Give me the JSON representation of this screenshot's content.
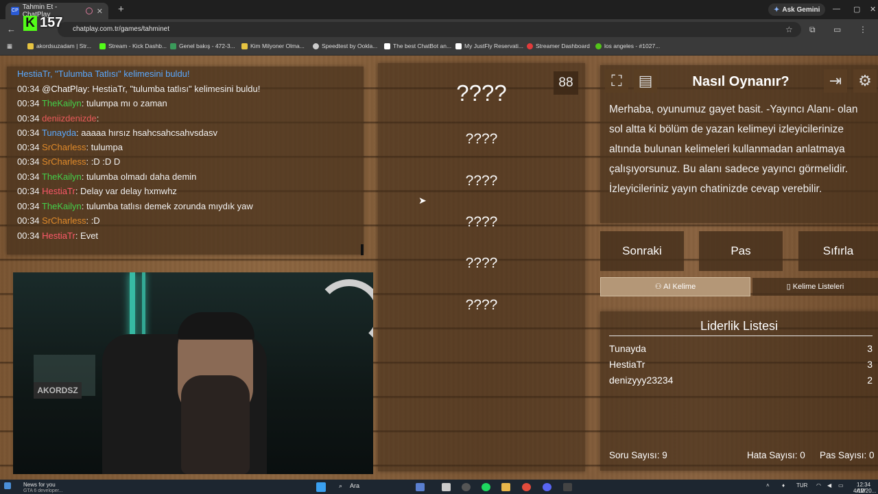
{
  "browser": {
    "tab_title": "Tahmin Et - ChatPlay",
    "url": "chatplay.com.tr/games/tahminet",
    "gemini_label": "Ask Gemini",
    "kick_count": "157",
    "bookmarks": [
      {
        "label": "akordsuzadam | Str...",
        "color": "#e7c441"
      },
      {
        "label": "Stream - Kick Dashb...",
        "color": "#53fc18"
      },
      {
        "label": "Genel bakış - 472-3...",
        "color": "#3a9a5a"
      },
      {
        "label": "Kim Milyoner Olma...",
        "color": "#e7c441"
      },
      {
        "label": "Speedtest by Ookla...",
        "color": "#cccccc"
      },
      {
        "label": "The best ChatBot an...",
        "color": "#ffffff"
      },
      {
        "label": "My JustFly Reservati...",
        "color": "#ffffff"
      },
      {
        "label": "Streamer Dashboard",
        "color": "#e23b3b"
      },
      {
        "label": "los angeles - #1027...",
        "color": "#53c41a"
      }
    ]
  },
  "chat": {
    "header": "HestiaTr, \"Tulumba Tatlısı\" kelimesini buldu!",
    "lines": [
      {
        "time": "00:34",
        "user": "@ChatPlay",
        "msg": ": HestiaTr, \"tulumba tatlısı\" kelimesini buldu!",
        "color": "#ffffff"
      },
      {
        "time": "00:34",
        "user": "TheKailyn",
        "msg": ": tulumpa mı o zaman",
        "color": "#43d14a"
      },
      {
        "time": "00:34",
        "user": "deniizdenizde",
        "msg": ":",
        "color": "#e85a5a"
      },
      {
        "time": "00:34",
        "user": "Tunayda",
        "msg": ": aaaaa hırsız hsahcsahcsahvsdasv",
        "color": "#5aa9ff"
      },
      {
        "time": "00:34",
        "user": "SrCharless",
        "msg": ": tulumpa",
        "color": "#e08a2a"
      },
      {
        "time": "00:34",
        "user": "SrCharless",
        "msg": ": :D :D D",
        "color": "#e08a2a"
      },
      {
        "time": "00:34",
        "user": "TheKailyn",
        "msg": ": tulumba olmadı daha demin",
        "color": "#43d14a"
      },
      {
        "time": "00:34",
        "user": "HestiaTr",
        "msg": ": Delay var delay hxmwhz",
        "color": "#ff5a6a"
      },
      {
        "time": "00:34",
        "user": "TheKailyn",
        "msg": ": tulumba tatlısı demek zorunda mıydık yaw",
        "color": "#43d14a"
      },
      {
        "time": "00:34",
        "user": "SrCharless",
        "msg": ": :D",
        "color": "#e08a2a"
      },
      {
        "time": "00:34",
        "user": "HestiaTr",
        "msg": ": Evet",
        "color": "#ff5a6a"
      }
    ]
  },
  "game": {
    "timer": "88",
    "main_word": "????",
    "words": [
      "????",
      "????",
      "????",
      "????",
      "????"
    ]
  },
  "howto": {
    "title": "Nasıl Oynanır?",
    "text": "Merhaba, oyunumuz gayet basit. -Yayıncı Alanı- olan sol altta ki bölüm de yazan kelimeyi izleyicilerinize altında bulunan kelimeleri kullanmadan anlatmaya çalışıyorsunuz. Bu alanı sadece yayıncı görmelidir. İzleyicileriniz yayın chatinizde cevap verebilir."
  },
  "controls": {
    "next": "Sonraki",
    "pass": "Pas",
    "reset": "Sıfırla",
    "ai_word": "AI Kelime",
    "word_lists": "Kelime Listeleri"
  },
  "leaderboard": {
    "title": "Liderlik Listesi",
    "rows": [
      {
        "name": "Tunayda",
        "score": "3"
      },
      {
        "name": "HestiaTr",
        "score": "3"
      },
      {
        "name": "denizyyy23234",
        "score": "2"
      }
    ],
    "questions": "Soru Sayısı: 9",
    "errors": "Hata Sayısı: 0",
    "passes": "Pas Sayısı: 0"
  },
  "taskbar": {
    "news_title": "News for you",
    "news_sub": "GTA 6 developer...",
    "search": "Ara",
    "lang": "TUR",
    "time": "12:34 AM",
    "date": "4/12/20..."
  }
}
